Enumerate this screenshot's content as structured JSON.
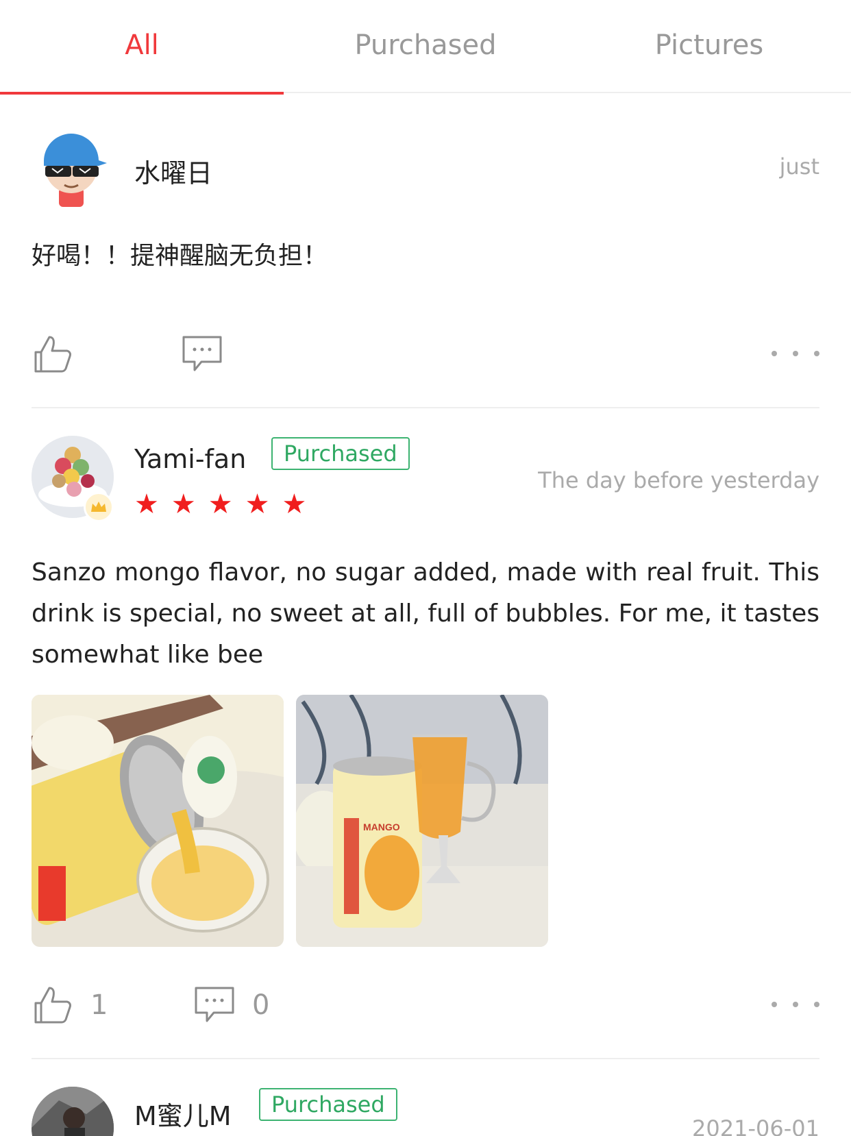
{
  "tabs": [
    {
      "label": "All",
      "active": true
    },
    {
      "label": "Purchased",
      "active": false
    },
    {
      "label": "Pictures",
      "active": false
    }
  ],
  "accent_color": "#f0393c",
  "purchased_color": "#2fa862",
  "reviews": [
    {
      "username": "水曜日",
      "time": "just",
      "text": "好喝！！提神醒脑无负担！",
      "avatar_icon": "cartoon-boy-sunglasses-avatar",
      "likes": null,
      "comments": null
    },
    {
      "username": "Yami-fan",
      "badge": "Purchased",
      "time": "The day before yesterday",
      "rating": 5,
      "text": "Sanzo mongo flavor, no sugar added, made with real fruit. This drink is special, no sweet at all, full of bubbles. For me, it tastes somewhat like bee",
      "avatar_icon": "food-plate-avatar",
      "likes": "1",
      "comments": "0",
      "photos": [
        "mango-can-pouring-photo",
        "mango-can-and-glass-photo"
      ]
    },
    {
      "username": "M蜜儿M",
      "badge": "Purchased",
      "time": "2021-06-01",
      "avatar_icon": "person-photo-avatar"
    }
  ]
}
